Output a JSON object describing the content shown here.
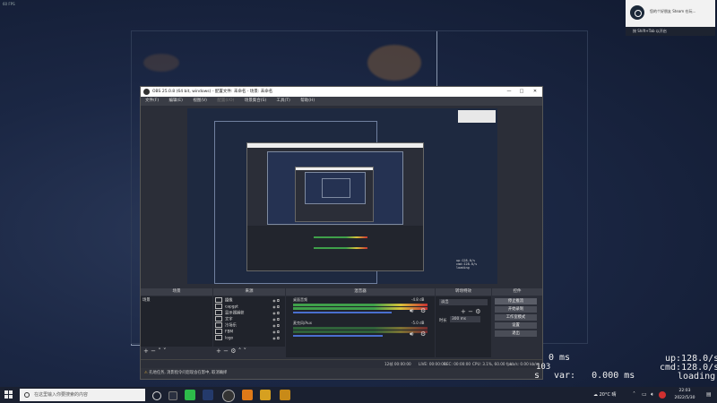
{
  "fps_overlay": "60 FPS",
  "steam_notification": {
    "message": "您的个好朋友 Steam 在玩...",
    "bar_text": "按 Shift+Tab 以开启"
  },
  "obs": {
    "title": "OBS 25.0.8 (64 bit, windows) - 配置文件: 未命名 - 场景: 未命名",
    "window_buttons": [
      "—",
      "□",
      "✕"
    ],
    "menu": [
      "文件(F)",
      "编辑(E)",
      "视图(V)",
      "配置(I/O)",
      "场景集合(S)",
      "工具(T)",
      "帮助(H)"
    ],
    "docks": {
      "scenes": "场景",
      "sources": "来源",
      "mixer": "混音器",
      "transitions": "转场特效",
      "controls": "控件"
    },
    "scene_list": [
      "场景"
    ],
    "sources": [
      {
        "name": "摄像",
        "icon": "camera-icon"
      },
      {
        "name": "capgpt",
        "icon": "capture-icon"
      },
      {
        "name": "显示器捕获",
        "icon": "monitor-icon"
      },
      {
        "name": "文字",
        "icon": "text-icon"
      },
      {
        "name": "冷场乐",
        "icon": "audio-icon"
      },
      {
        "name": "FBM",
        "icon": "image-icon"
      },
      {
        "name": "logo",
        "icon": "image-icon"
      }
    ],
    "mixer": {
      "channels": [
        {
          "name": "桌面音频",
          "db": "-4.8 dB",
          "level": 0.85
        },
        {
          "name": "麦克风/Aux",
          "db": "-5.0 dB",
          "level": 0.7
        }
      ]
    },
    "transition": {
      "type": "淡出",
      "duration_label": "时长",
      "duration_value": "300 ms"
    },
    "controls": [
      "停止推流",
      "开始录制",
      "工作室模式",
      "设置",
      "退出"
    ],
    "status": {
      "dropped": "12帧 00:00:00",
      "live": "LIVE: 00:00:00",
      "rec": "REC: 00:00:00",
      "cpu": "CPU: 3.1%, 60.00 fps",
      "kbps": "kb/s: 0.00 kb/s"
    },
    "notice": "孔地任务, 消影指令问您现会在影中, 取消确择"
  },
  "overlay_stats": {
    "ms1": "0 ms",
    "num": "103",
    "var": "var:   0.000 ms",
    "s": "s",
    "up": "up:128.0/s",
    "cmd": "cmd:128.0/s",
    "loading": "loading"
  },
  "taskbar": {
    "search_placeholder": "在这里输入你要搜索的内容",
    "weather": "20°C 晴",
    "time": "22:03",
    "date": "2022/5/30"
  }
}
